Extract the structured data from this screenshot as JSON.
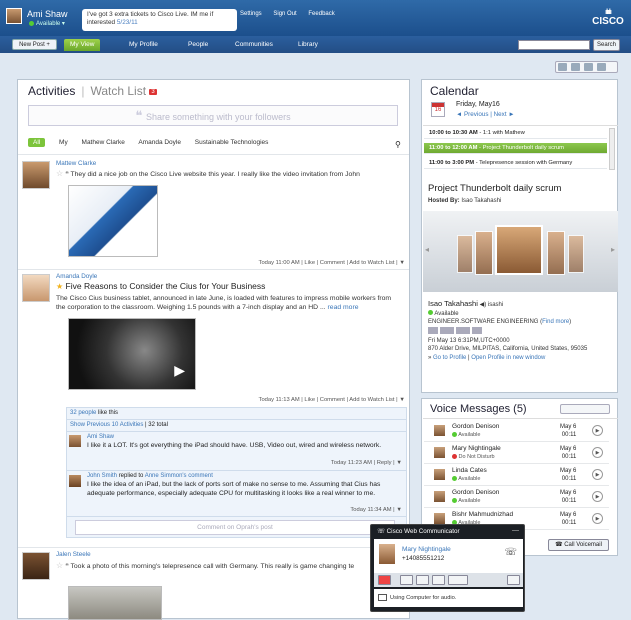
{
  "user": {
    "name": "Ami Shaw",
    "status": "Available"
  },
  "status_message": {
    "text": "I've got 3 extra tickets to Cisco Live. IM me if interested",
    "date": "5/23/11"
  },
  "top_links": [
    "Settings",
    "Sign Out",
    "Feedback"
  ],
  "logo": "CISCO",
  "nav": {
    "new_post": "New Post +",
    "tabs": [
      "My View",
      "My Profile",
      "People",
      "Communities",
      "Library"
    ],
    "search_button": "Search"
  },
  "activities": {
    "tab_activities": "Activities",
    "tab_watch": "Watch List",
    "watch_count": "3",
    "share_placeholder": "Share something with your followers",
    "filters": [
      "All",
      "My",
      "Mathew Clarke",
      "Amanda Doyle",
      "Sustainable Technologies"
    ],
    "posts": [
      {
        "author": "Mattew Clarke",
        "text": "They did a nice job on the Cisco Live website this year. I really like the video invitation from John",
        "meta": "Today 11:00 AM  |  Like  |  Comment  |  Add to Watch List  |  ▼"
      },
      {
        "author": "Amanda Doyle",
        "title": "Five Reasons to Consider the Cius for Your Business",
        "text": "The Cisco Cius business tablet, announced in late June, is loaded with features to impress mobile workers from the corporation to the classroom. Weighing 1.5 pounds with a 7-inch display and an HD ...",
        "read_more": "read more",
        "meta": "Today 11:13 AM  |  Like  |  Comment  |  Add to Watch List  |  ▼",
        "likes": "32 people",
        "likes_suffix": "like this",
        "prev_activities": "Show Previous 10 Activities",
        "total": "32 total",
        "comments": [
          {
            "author": "Ami Shaw",
            "text": "I like it a LOT. It's got everything the iPad should have. USB, Video out, wired and wireless network.",
            "meta": "Today 11:23 AM  |  Reply  |  ▼"
          },
          {
            "author": "John Smith",
            "action": "replied to",
            "target": "Anne Simmon's comment",
            "text": "I like the idea of an iPad, but the lack of ports sort of make no sense to me. Assuming that Cius has adequate performance, especially adequate CPU for multitasking it looks like a real winner to me.",
            "meta": "Today 11:34 AM  |  ▼"
          }
        ],
        "comment_placeholder": "Comment on Oprah's post"
      },
      {
        "author": "Jalen Steele",
        "text": "Took a photo of this morning's telepresence call with Germany. This really is game changing te"
      }
    ]
  },
  "calendar": {
    "title": "Calendar",
    "date": "Friday, May16",
    "day_num": "16",
    "prev": "◄ Previous",
    "next": "Next ►",
    "events": [
      {
        "time": "10:00 to 10:30 AM",
        "title": "1:1 with Mathew"
      },
      {
        "time": "11:00 to 12:00 AM",
        "title": "Project Thunderbolt daily scrum"
      },
      {
        "time": "11:00 to 3:00 PM",
        "title": "Telepresence session with Germany"
      }
    ],
    "selected_title": "Project Thunderbolt daily scrum",
    "hosted_label": "Hosted By:",
    "host": "Isao Takahashi",
    "person": {
      "name": "Isao Takahashi",
      "handle": "isashi",
      "status": "Available",
      "role": "ENGINEER.SOFTWARE ENGINEERING",
      "find_more": "Find more",
      "time": "Fri May 13 6:31PM,UTC+0000",
      "address": "870 Alder Drive, MILPITAS, California, United States, 95035",
      "profile": "Go to Profile",
      "new_window": "Open Profile in new window"
    }
  },
  "voice": {
    "title": "Voice Messages (5)",
    "messages": [
      {
        "name": "Gordon Denison",
        "status": "Available",
        "date": "May 6",
        "duration": "00:11",
        "dnd": false
      },
      {
        "name": "Mary Nightingale",
        "status": "Do Not Disturb",
        "date": "May 6",
        "duration": "00:11",
        "dnd": true
      },
      {
        "name": "Linda Cates",
        "status": "Available",
        "date": "May 6",
        "duration": "00:11",
        "dnd": false
      },
      {
        "name": "Gordon Denison",
        "status": "Available",
        "date": "May 6",
        "duration": "00:11",
        "dnd": false
      },
      {
        "name": "Bishr Mahmudnizhad",
        "status": "Available",
        "date": "May 6",
        "duration": "00:11",
        "dnd": false
      }
    ],
    "call_button": "Call Voicemail"
  },
  "web_communicator": {
    "title": "Cisco Web Communicator",
    "contact": "Mary Nightingale",
    "phone": "+14085551212",
    "audio": "Using Computer for audio."
  }
}
